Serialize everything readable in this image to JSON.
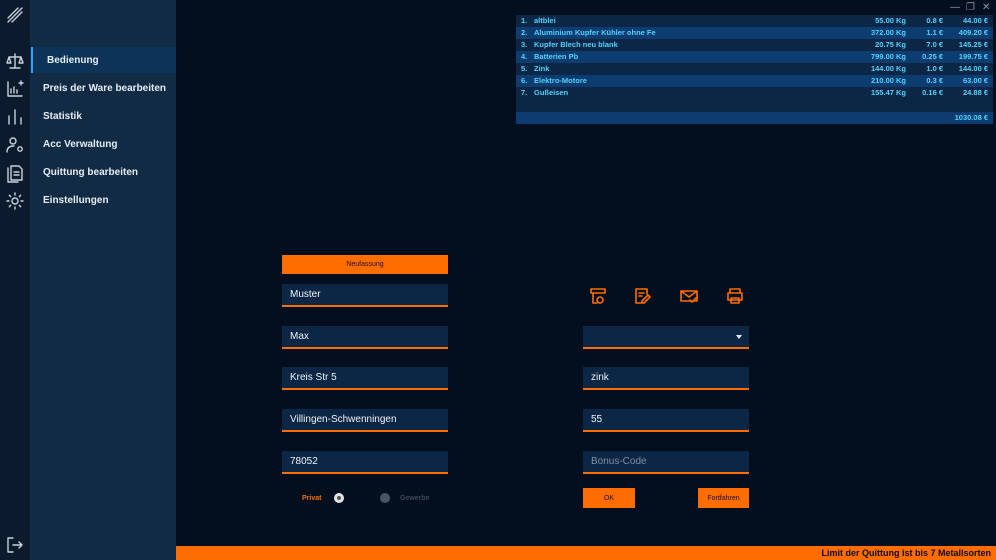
{
  "nav": {
    "items": [
      {
        "label": "Bedienung",
        "active": true
      },
      {
        "label": "Preis der Ware bearbeiten",
        "active": false
      },
      {
        "label": "Statistik",
        "active": false
      },
      {
        "label": "Acc Verwaltung",
        "active": false
      },
      {
        "label": "Quittung bearbeiten",
        "active": false
      },
      {
        "label": "Einstellungen",
        "active": false
      }
    ]
  },
  "window_controls": {
    "minimize": "—",
    "restore": "❐",
    "close": "✕"
  },
  "items_table": {
    "rows": [
      {
        "num": "1.",
        "name": "altblei",
        "weight": "55.00 Kg",
        "price": "0.8 €",
        "total": "44.00 €"
      },
      {
        "num": "2.",
        "name": "Aluminium Kupfer Kühler ohne Fe",
        "weight": "372.00 Kg",
        "price": "1.1 €",
        "total": "409.20 €"
      },
      {
        "num": "3.",
        "name": "Kupfer Blech neu blank",
        "weight": "20.75 Kg",
        "price": "7.0 €",
        "total": "145.25 €"
      },
      {
        "num": "4.",
        "name": "Batterien Pb",
        "weight": "799.00 Kg",
        "price": "0.25 €",
        "total": "199.75 €"
      },
      {
        "num": "5.",
        "name": "Zink",
        "weight": "144.00 Kg",
        "price": "1.0 €",
        "total": "144.00 €"
      },
      {
        "num": "6.",
        "name": "Elektro-Motore",
        "weight": "210.00 Kg",
        "price": "0.3 €",
        "total": "63.00 €"
      },
      {
        "num": "7.",
        "name": "Gußeisen",
        "weight": "155.47 Kg",
        "price": "0.16 €",
        "total": "24.88 €"
      }
    ],
    "grand_total": "1030.08 €"
  },
  "form": {
    "new_button": "Neufassung",
    "last_name": "Muster",
    "first_name": "Max",
    "street": "Kreis Str 5",
    "city": "Villingen-Schwenningen",
    "zip": "78052",
    "private_label": "Privat",
    "business_label": "Gewerbe",
    "selected_customer_type": "Privat",
    "material_dropdown": "",
    "material": "zink",
    "quantity": "55",
    "bonus_placeholder": "Bonus-Code",
    "ok_button": "OK",
    "continue_button": "Fortfahren"
  },
  "actions": [
    "preview-receipt-icon",
    "edit-receipt-icon",
    "email-icon",
    "print-icon"
  ],
  "footer": {
    "message": "Limit der Quittung ist bis 7 Metallsorten"
  },
  "colors": {
    "accent": "#ff6d00",
    "highlight": "#4fd3ff",
    "nav_active": "#28a2ff"
  }
}
